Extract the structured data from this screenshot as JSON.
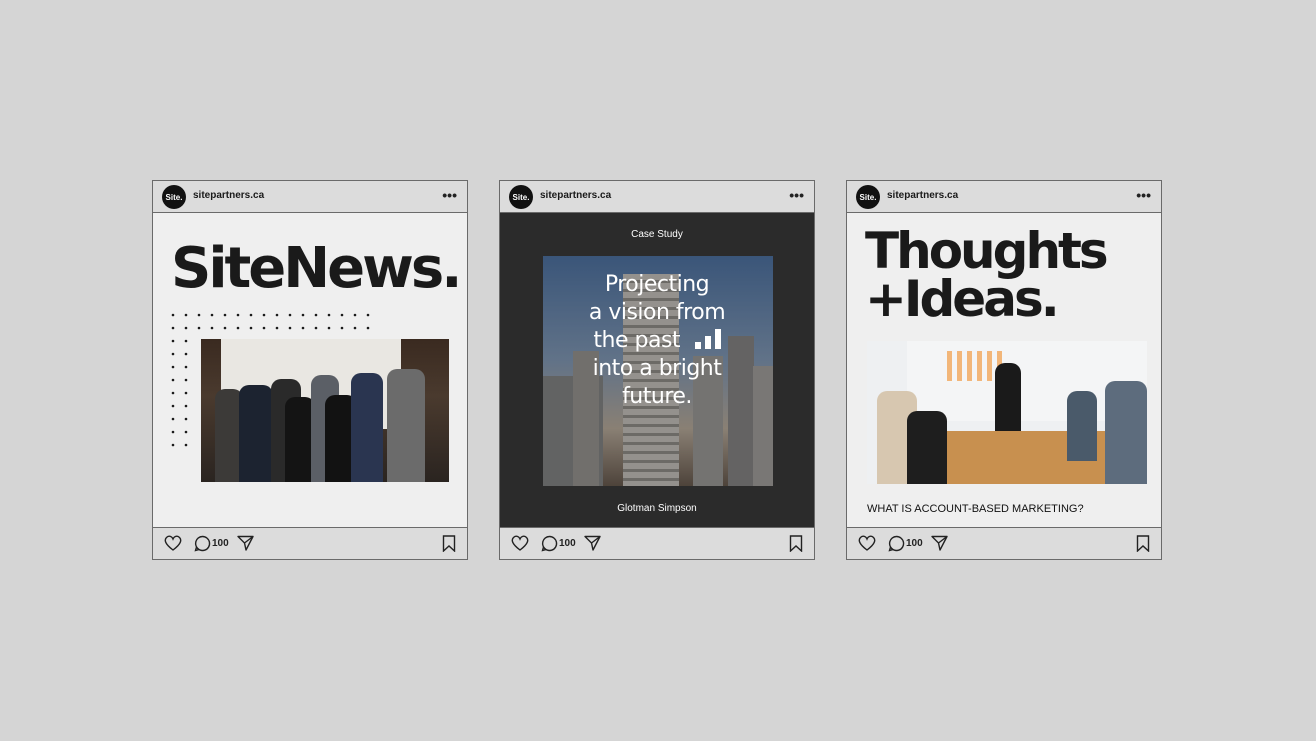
{
  "posts": [
    {
      "handle": "sitepartners.ca",
      "avatar_text": "Site.",
      "menu": "•••",
      "title": "SiteNews.",
      "comment_count": "100"
    },
    {
      "handle": "sitepartners.ca",
      "avatar_text": "Site.",
      "menu": "•••",
      "label": "Case Study",
      "headline_lines": [
        "Projecting",
        "a vision from",
        "the past",
        "into a bright",
        "future."
      ],
      "client": "Glotman Simpson",
      "comment_count": "100"
    },
    {
      "handle": "sitepartners.ca",
      "avatar_text": "Site.",
      "menu": "•••",
      "title_line1": "Thoughts",
      "title_line2": "+Ideas.",
      "caption": "WHAT IS ACCOUNT-BASED MARKETING?",
      "comment_count": "100"
    }
  ],
  "icons": [
    "heart-icon",
    "comment-icon",
    "send-icon",
    "bookmark-icon",
    "more-icon",
    "bar-chart-icon"
  ],
  "colors": {
    "background": "#d5d5d5",
    "card": "#efefef",
    "dark_panel": "#2b2b2b",
    "text": "#1a1a1a"
  }
}
